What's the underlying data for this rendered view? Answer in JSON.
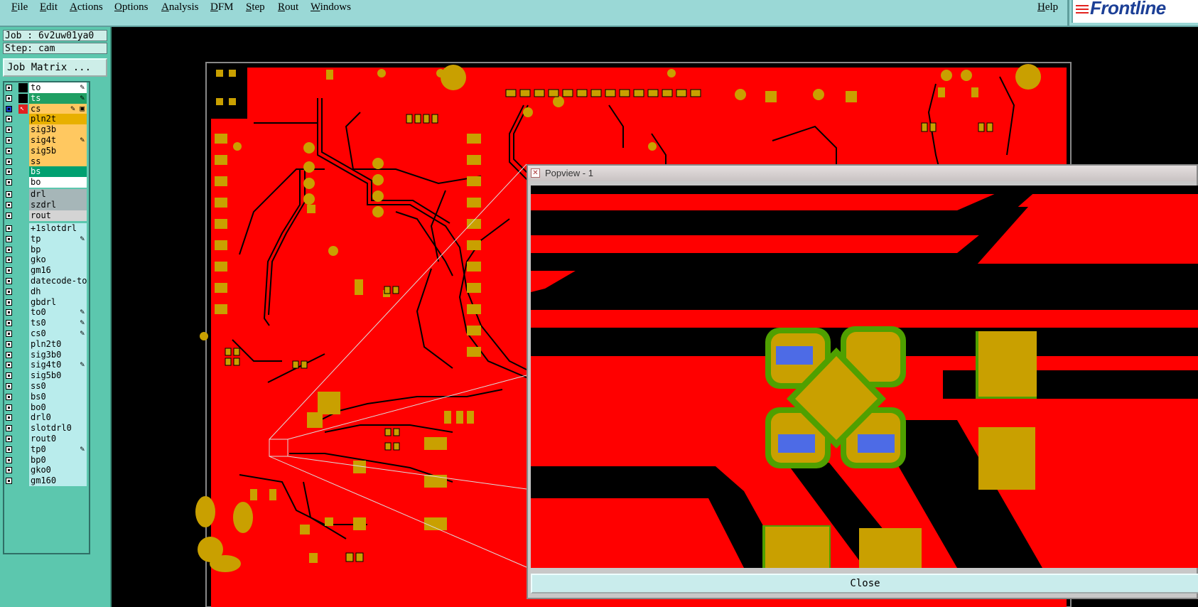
{
  "menu": {
    "items": [
      "File",
      "Edit",
      "Actions",
      "Options",
      "Analysis",
      "DFM",
      "Step",
      "Rout",
      "Windows"
    ],
    "help": "Help",
    "logo": "Frontline"
  },
  "job": {
    "job_label": "Job : 6v2uw01ya0",
    "step_label": "Step: cam",
    "matrix_button": "Job Matrix ..."
  },
  "layers": {
    "board": [
      {
        "name": "to",
        "mark": "✎"
      },
      {
        "name": "ts",
        "mark": "✎"
      },
      {
        "name": "cs",
        "mark": "✎ ▣"
      },
      {
        "name": "pln2t",
        "mark": ""
      },
      {
        "name": "sig3b",
        "mark": ""
      },
      {
        "name": "sig4t",
        "mark": "✎"
      },
      {
        "name": "sig5b",
        "mark": ""
      },
      {
        "name": "ss",
        "mark": ""
      },
      {
        "name": "bs",
        "mark": ""
      },
      {
        "name": "bo",
        "mark": ""
      }
    ],
    "drill": [
      {
        "name": "drl",
        "mark": ""
      },
      {
        "name": "szdrl",
        "mark": ""
      },
      {
        "name": "rout",
        "mark": ""
      }
    ],
    "misc": [
      {
        "name": "+1slotdrl",
        "mark": ""
      },
      {
        "name": "tp",
        "mark": "✎"
      },
      {
        "name": "bp",
        "mark": ""
      },
      {
        "name": "gko",
        "mark": ""
      },
      {
        "name": "gm16",
        "mark": ""
      },
      {
        "name": "datecode-to",
        "mark": ""
      },
      {
        "name": "dh",
        "mark": ""
      },
      {
        "name": "gbdrl",
        "mark": ""
      },
      {
        "name": "to0",
        "mark": "✎"
      },
      {
        "name": "ts0",
        "mark": "✎"
      },
      {
        "name": "cs0",
        "mark": "✎"
      },
      {
        "name": "pln2t0",
        "mark": ""
      },
      {
        "name": "sig3b0",
        "mark": ""
      },
      {
        "name": "sig4t0",
        "mark": "✎"
      },
      {
        "name": "sig5b0",
        "mark": ""
      },
      {
        "name": "ss0",
        "mark": ""
      },
      {
        "name": "bs0",
        "mark": ""
      },
      {
        "name": "bo0",
        "mark": ""
      },
      {
        "name": "drl0",
        "mark": ""
      },
      {
        "name": "slotdrl0",
        "mark": ""
      },
      {
        "name": "rout0",
        "mark": ""
      },
      {
        "name": "tp0",
        "mark": "✎"
      },
      {
        "name": "bp0",
        "mark": ""
      },
      {
        "name": "gko0",
        "mark": ""
      },
      {
        "name": "gm160",
        "mark": ""
      }
    ]
  },
  "popview": {
    "title": "Popview - 1",
    "close_label": "Close"
  },
  "colors": {
    "copper": "#ff0000",
    "pad": "#c9a000",
    "soldermask": "#4fa000",
    "drill": "#4d6be6",
    "active_layer_bg": "#ffcc66",
    "bs_layer_bg": "#00a070"
  },
  "icons": [
    "close-icon",
    "affected-arrow-icon",
    "edit-pencil-icon"
  ]
}
